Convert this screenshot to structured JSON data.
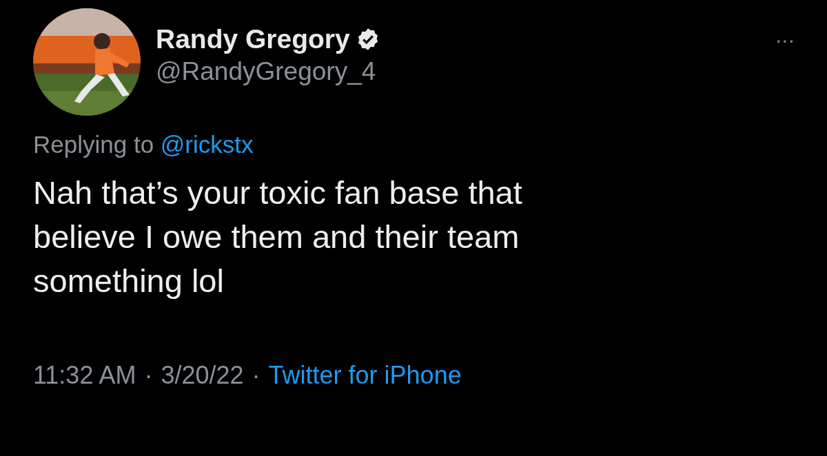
{
  "author": {
    "name": "Randy Gregory",
    "verified": true,
    "handle": "@RandyGregory_4"
  },
  "more": "···",
  "reply": {
    "prefix": "Replying to",
    "mention": "@rickstx"
  },
  "text": "Nah that’s your toxic fan base that\nbelieve I owe them and their team\nsomething lol",
  "footer": [
    {
      "kind": "text",
      "text": "11:32 AM"
    },
    {
      "kind": "sep",
      "text": "·"
    },
    {
      "kind": "text",
      "text": "3/20/22"
    },
    {
      "kind": "sep",
      "text": "·"
    },
    {
      "kind": "link",
      "text": "Twitter for iPhone"
    }
  ]
}
